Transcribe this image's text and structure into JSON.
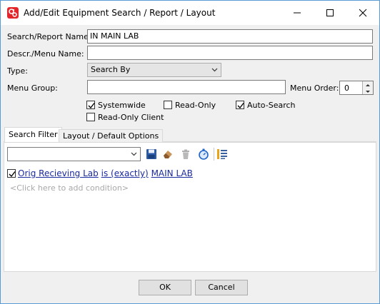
{
  "window": {
    "title": "Add/Edit Equipment Search / Report / Layout",
    "icons": [
      "app-icon",
      "minimize-icon",
      "maximize-icon",
      "close-icon"
    ]
  },
  "form": {
    "search_report_name_label": "Search/Report Name:",
    "search_report_name_value": "IN MAIN LAB",
    "descr_menu_name_label": "Descr./Menu Name:",
    "descr_menu_name_value": "",
    "type_label": "Type:",
    "type_value": "Search By",
    "menu_group_label": "Menu Group:",
    "menu_group_value": "",
    "menu_order_label": "Menu Order:",
    "menu_order_value": "0",
    "checkboxes": {
      "systemwide": {
        "label": "Systemwide",
        "checked": true
      },
      "read_only": {
        "label": "Read-Only",
        "checked": false
      },
      "auto_search": {
        "label": "Auto-Search",
        "checked": true
      },
      "read_only_client": {
        "label": "Read-Only Client",
        "checked": false
      }
    }
  },
  "tabs": [
    {
      "label": "Search Filter",
      "active": true
    },
    {
      "label": "Layout / Default Options",
      "active": false
    }
  ],
  "filter_toolbar": {
    "saved_filter_value": "",
    "icons": [
      "save-icon",
      "eraser-icon",
      "delete-icon",
      "timer-icon",
      "list-icon"
    ]
  },
  "condition": {
    "checked": true,
    "field": "Orig Recieving Lab",
    "operator": "is (exactly)",
    "value": "MAIN LAB"
  },
  "add_condition_hint": "<Click here to add condition>",
  "buttons": {
    "ok_label": "OK",
    "cancel_label": "Cancel"
  }
}
